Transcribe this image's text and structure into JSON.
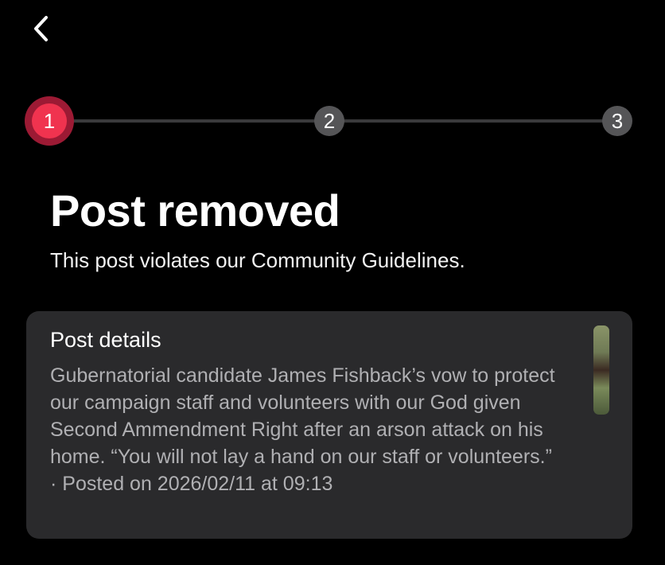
{
  "header": {
    "back_icon": "chevron-left-icon"
  },
  "stepper": {
    "steps": [
      {
        "label": "1",
        "state": "active"
      },
      {
        "label": "2",
        "state": "inactive"
      },
      {
        "label": "3",
        "state": "inactive"
      }
    ],
    "active_color": "#f0334f",
    "inactive_color": "#555557"
  },
  "main": {
    "title": "Post removed",
    "subtitle": "This post violates our Community Guidelines."
  },
  "post_details": {
    "heading": "Post details",
    "text": "Gubernatorial candidate James Fishback’s vow to protect our campaign staff and volunteers with our God given Second Ammendment Right after an arson attack on his home. “You will not lay a hand on our staff or volunteers.”",
    "meta": "· Posted on 2026/02/11 at 09:13"
  }
}
